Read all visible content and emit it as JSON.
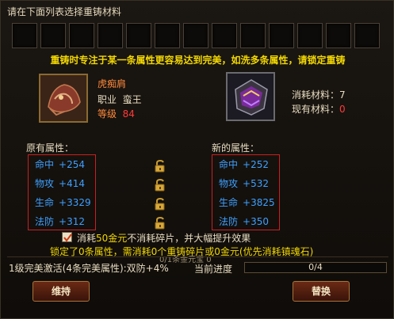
{
  "title": "请在下面列表选择重铸材料",
  "slot_count": 13,
  "tip": "重铸时专注于某一条属性更容易达到完美，如洗多条属性，请锁定重铸",
  "item": {
    "name": "虎痴肩",
    "job_label": "职业",
    "job_value": "蛮王",
    "level_label": "等级",
    "level_value": "84",
    "icon": "pauldron-icon"
  },
  "material": {
    "icon": "gem-icon",
    "cost_label": "消耗材料：",
    "cost_value": "7",
    "own_label": "现有材料：",
    "own_value": "0"
  },
  "original_title": "原有属性：",
  "new_title": "新的属性：",
  "original_attrs": [
    {
      "name": "命中",
      "value": "+254"
    },
    {
      "name": "物攻",
      "value": "+414"
    },
    {
      "name": "生命",
      "value": "+3329"
    },
    {
      "name": "法防",
      "value": "+312"
    }
  ],
  "new_attrs": [
    {
      "name": "命中",
      "value": "+252"
    },
    {
      "name": "物攻",
      "value": "+532"
    },
    {
      "name": "生命",
      "value": "+3825"
    },
    {
      "name": "法防",
      "value": "+350"
    }
  ],
  "option": {
    "checked": true,
    "text_prefix": "消耗",
    "text_gold": "50金元",
    "text_suffix": "不消耗碎片，并大幅提升效果"
  },
  "lock_line": "锁定了0条属性，需消耗0个重铸碎片或0金元(优先消耗镇魂石)",
  "overlay_line": "0/1条金元宝 0",
  "perfect_line": "1级完美激活(4条完美属性):双防+4%",
  "progress": {
    "label": "当前进度",
    "text": "0/4",
    "fraction": 0
  },
  "buttons": {
    "keep": "维持",
    "replace": "替换"
  },
  "colors": {
    "tip": "#f2d700",
    "item_name": "#ff8a3c",
    "level": "#ff3a3a",
    "attr": "#3da0ff",
    "highlight_box": "#c92020",
    "gold": "#f2d700"
  }
}
